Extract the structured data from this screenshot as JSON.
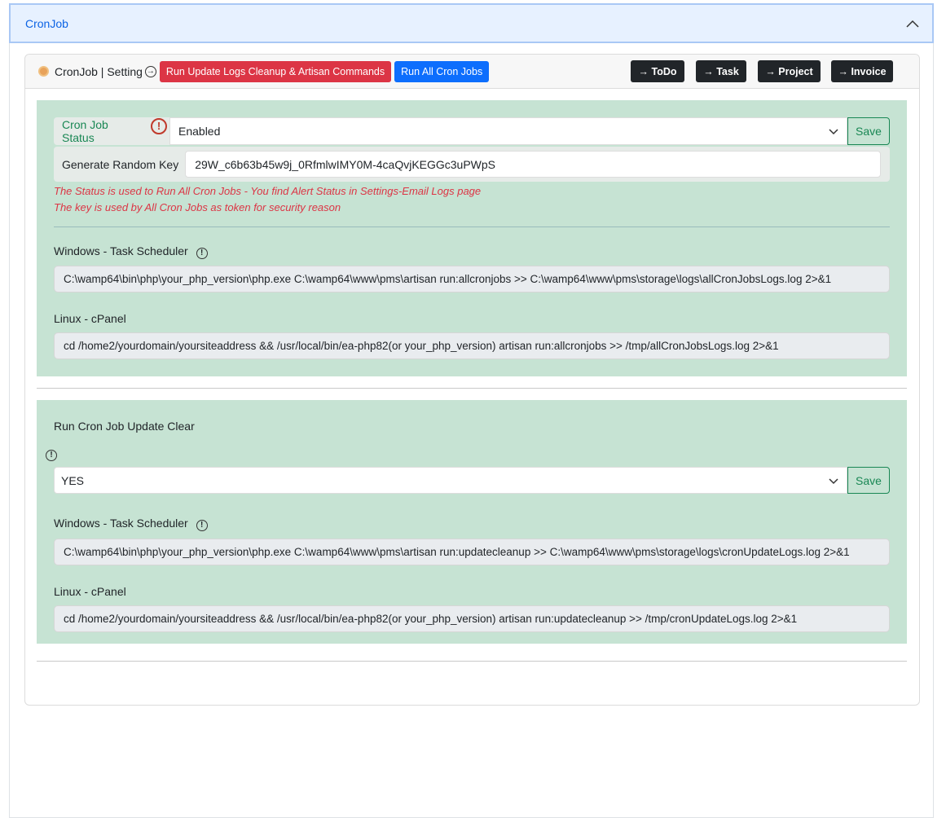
{
  "accordion": {
    "title": "CronJob"
  },
  "card": {
    "title": "CronJob | Setting",
    "run_cleanup": "Run Update Logs Cleanup & Artisan Commands",
    "run_all": "Run All Cron Jobs",
    "links": [
      "ToDo",
      "Task",
      "Project",
      "Invoice"
    ]
  },
  "section1": {
    "status_label": "Cron Job Status",
    "status_value": "Enabled",
    "save": "Save",
    "key_label": "Generate Random Key",
    "key_value": "29W_c6b63b45w9j_0RfmlwIMY0M-4caQvjKEGGc3uPWpS",
    "note1": "The Status is used to Run All Cron Jobs - You find Alert Status in Settings-Email Logs page",
    "note2": "The key is used by All Cron Jobs as token for security reason",
    "windows_label": "Windows - Task Scheduler",
    "windows_cmd": "C:\\wamp64\\bin\\php\\your_php_version\\php.exe C:\\wamp64\\www\\pms\\artisan run:allcronjobs >> C:\\wamp64\\www\\pms\\storage\\logs\\allCronJobsLogs.log 2>&1",
    "linux_label": "Linux - cPanel",
    "linux_cmd": "cd /home2/yourdomain/yoursiteaddress && /usr/local/bin/ea-php82(or your_php_version) artisan run:allcronjobs >> /tmp/allCronJobsLogs.log 2>&1"
  },
  "section2": {
    "title": "Run Cron Job Update Clear",
    "value": "YES",
    "save": "Save",
    "windows_label": "Windows - Task Scheduler",
    "windows_cmd": "C:\\wamp64\\bin\\php\\your_php_version\\php.exe C:\\wamp64\\www\\pms\\artisan run:updatecleanup >> C:\\wamp64\\www\\pms\\storage\\logs\\cronUpdateLogs.log 2>&1",
    "linux_label": "Linux - cPanel",
    "linux_cmd": "cd /home2/yourdomain/yoursiteaddress && /usr/local/bin/ea-php82(or your_php_version) artisan run:updatecleanup >> /tmp/cronUpdateLogs.log 2>&1"
  }
}
